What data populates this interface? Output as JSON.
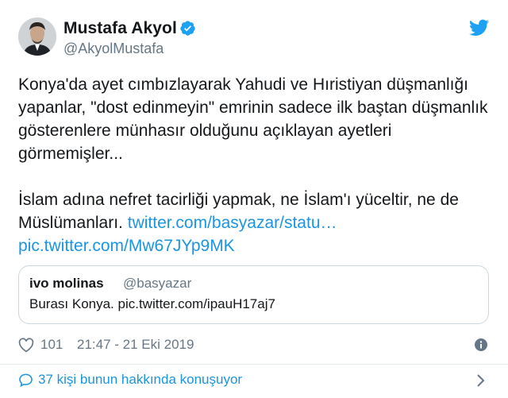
{
  "author": {
    "name": "Mustafa Akyol",
    "handle": "@AkyolMustafa"
  },
  "tweet": {
    "paragraph1": "Konya'da ayet cımbızlayarak Yahudi ve Hıristiyan düşmanlığı yapanlar, \"dost edinmeyin\" emrinin sadece ilk baştan düşmanlık gösterenlere münhasır olduğunu açıklayan ayetleri görmemişler...",
    "paragraph2": "İslam adına nefret tacirliği yapmak, ne İslam'ı yüceltir, ne de Müslümanları.",
    "link1": "twitter.com/basyazar/statu…",
    "link2": "pic.twitter.com/Mw67JYp9MK"
  },
  "quoted": {
    "name": "ivo molinas",
    "handle": "@basyazar",
    "text": "Burası Konya. pic.twitter.com/ipauH17aj7"
  },
  "meta": {
    "likes": "101",
    "timestamp": "21:47 - 21 Eki 2019"
  },
  "conversation": {
    "label": "37 kişi bunun hakkında konuşuyor"
  },
  "icons": {
    "verified": "verified-badge-icon",
    "twitter": "twitter-bird-icon",
    "like": "heart-icon",
    "info": "info-icon",
    "reply": "speech-bubble-icon",
    "chevron": "chevron-right-icon"
  },
  "colors": {
    "link": "#1b95e0",
    "secondary": "#657786",
    "border": "#ccd6dd",
    "text": "#14171a"
  }
}
